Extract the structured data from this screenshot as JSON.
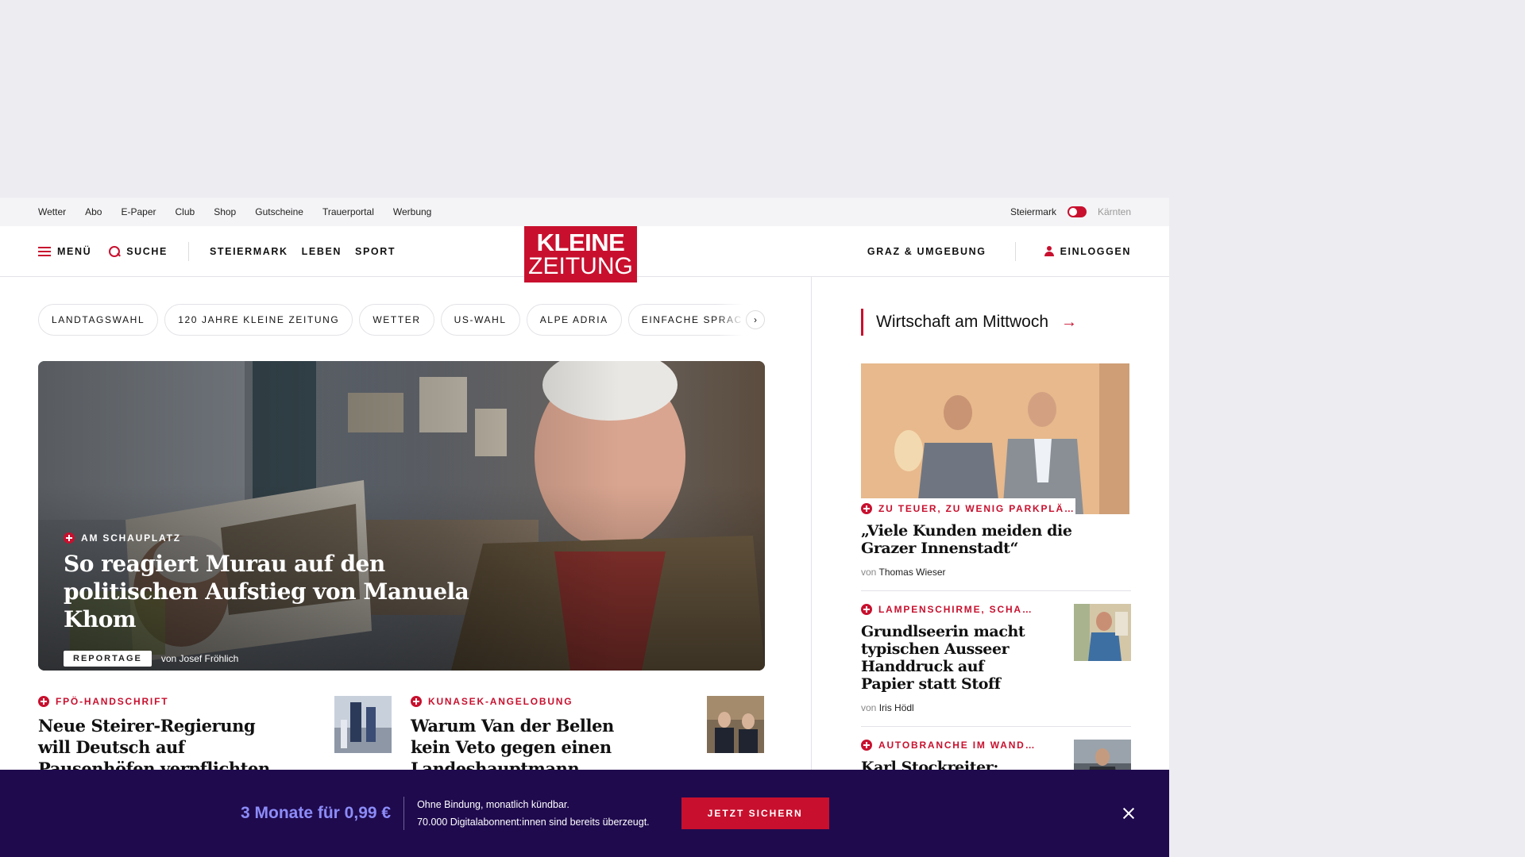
{
  "utility": {
    "links": [
      "Wetter",
      "Abo",
      "E-Paper",
      "Club",
      "Shop",
      "Gutscheine",
      "Trauerportal",
      "Werbung"
    ],
    "region_active": "Steiermark",
    "region_inactive": "Kärnten"
  },
  "header": {
    "menu_label": "MENÜ",
    "search_label": "SUCHE",
    "nav": [
      "STEIERMARK",
      "LEBEN",
      "SPORT"
    ],
    "logo_line1": "KLEINE",
    "logo_line2": "ZEITUNG",
    "region_link": "GRAZ & UMGEBUNG",
    "login_label": "EINLOGGEN"
  },
  "chips": [
    "LANDTAGSWAHL",
    "120 JAHRE KLEINE ZEITUNG",
    "WETTER",
    "US-WAHL",
    "ALPE ADRIA",
    "EINFACHE SPRACHE"
  ],
  "hero": {
    "kicker": "AM SCHAUPLATZ",
    "title": "So reagiert Murau auf den politischen Aufstieg von Manuela Khom",
    "badge": "REPORTAGE",
    "author": "von Josef Fröhlich"
  },
  "teasers": [
    {
      "kicker": "FPÖ-HANDSCHRIFT",
      "title": "Neue Steirer-Regierung will Deutsch auf Pausenhöfen verpflichten"
    },
    {
      "kicker": "KUNASEK-ANGELOBUNG",
      "title": "Warum Van der Bellen kein Veto gegen einen Landeshauptmann einlegen kann"
    }
  ],
  "sidebar": {
    "heading": "Wirtschaft am Mittwoch",
    "lead": {
      "kicker": "ZU TEUER, ZU WENIG PARKPLÄ…",
      "title": "„Viele Kunden meiden die Grazer Innenstadt“",
      "by_prefix": "von",
      "author": "Thomas Wieser"
    },
    "items": [
      {
        "kicker": "LAMPENSCHIRME, SCHA…",
        "title": "Grundlseerin macht typischen Ausseer Handdruck auf Papier statt Stoff",
        "by_prefix": "von",
        "author": "Iris Hödl"
      },
      {
        "kicker": "AUTOBRANCHE IM WAND…",
        "title": "Karl Stockreiter: „Gering…"
      }
    ]
  },
  "offer": {
    "price": "3 Monate für 0,99 €",
    "line1": "Ohne Bindung, monatlich kündbar.",
    "line2": "70.000 Digitalabonnent:innen sind bereits überzeugt.",
    "cta": "JETZT SICHERN"
  },
  "colors": {
    "brand_red": "#c8102e",
    "offer_bg": "#1f0a4e",
    "offer_price": "#8c8cf8",
    "page_bg": "#ececf1"
  }
}
